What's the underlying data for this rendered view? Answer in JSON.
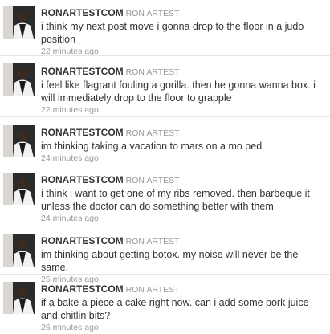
{
  "timeline": {
    "tweets": [
      {
        "screen_name": "RONARTESTCOM",
        "full_name": "RON ARTEST",
        "text": "i think my next post move i gonna drop to the floor in a judo position",
        "time": "22 minutes ago"
      },
      {
        "screen_name": "RONARTESTCOM",
        "full_name": "RON ARTEST",
        "text": "i feel like flagrant fouling a gorilla. then he gonna wanna box. i will immediately drop to the floor to grapple",
        "time": "22 minutes ago"
      },
      {
        "screen_name": "RONARTESTCOM",
        "full_name": "RON ARTEST",
        "text": "im thinking taking a vacation to mars on a mo ped",
        "time": "24 minutes ago"
      },
      {
        "screen_name": "RONARTESTCOM",
        "full_name": "RON ARTEST",
        "text": "i think i want to get one of my ribs removed. then barbeque it unless the doctor can do something better with them",
        "time": "24 minutes ago"
      },
      {
        "screen_name": "RONARTESTCOM",
        "full_name": "RON ARTEST",
        "text": "im thinking about getting botox. my noise will never be the same.",
        "time": "25 minutes ago"
      },
      {
        "screen_name": "RONARTESTCOM",
        "full_name": "RON ARTEST",
        "text": "if a bake a piece a cake right now. can i add some pork juice and chitlin bits?",
        "time": "26 minutes ago"
      }
    ]
  }
}
